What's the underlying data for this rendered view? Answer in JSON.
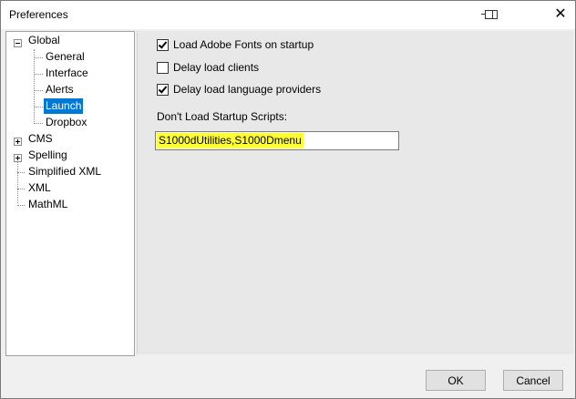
{
  "window": {
    "title": "Preferences"
  },
  "titlebar": {
    "pin_icon": "pin-icon",
    "close_icon": "close-icon",
    "close_glyph": "✕"
  },
  "tree": {
    "items": [
      {
        "label": "Global",
        "level": 0,
        "expander": "expanded"
      },
      {
        "label": "General",
        "level": 1
      },
      {
        "label": "Interface",
        "level": 1
      },
      {
        "label": "Alerts",
        "level": 1
      },
      {
        "label": "Launch",
        "level": 1,
        "selected": true
      },
      {
        "label": "Dropbox",
        "level": 1
      },
      {
        "label": "CMS",
        "level": 0,
        "expander": "collapsed"
      },
      {
        "label": "Spelling",
        "level": 0,
        "expander": "collapsed"
      },
      {
        "label": "Simplified XML",
        "level": 0
      },
      {
        "label": "XML",
        "level": 0
      },
      {
        "label": "MathML",
        "level": 0
      }
    ]
  },
  "launch": {
    "checkboxes": [
      {
        "label": "Load Adobe Fonts on startup",
        "checked": true
      },
      {
        "label": "Delay load clients",
        "checked": false
      },
      {
        "label": "Delay load language providers",
        "checked": true
      }
    ],
    "scripts_label": "Don't Load Startup Scripts:",
    "scripts_value": "S1000dUtilities,S1000Dmenu",
    "highlight_color": "#ffff33"
  },
  "buttons": {
    "ok": "OK",
    "cancel": "Cancel"
  },
  "colors": {
    "selection": "#0078d7"
  }
}
